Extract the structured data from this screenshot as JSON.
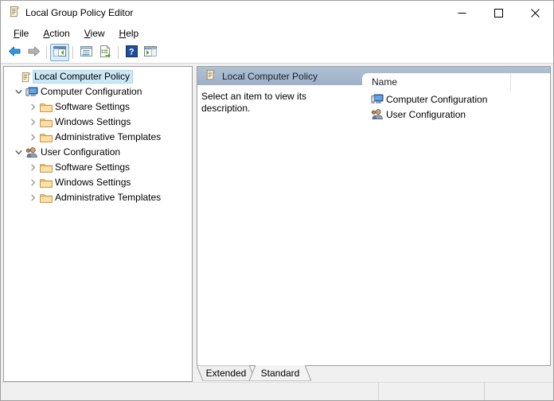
{
  "window": {
    "title": "Local Group Policy Editor",
    "app_icon": "policy-scroll-icon",
    "controls": {
      "minimize": "Minimize",
      "maximize": "Maximize",
      "close": "Close"
    }
  },
  "menubar": {
    "items": [
      {
        "label": "File",
        "accesskey": "F",
        "rest": "ile"
      },
      {
        "label": "Action",
        "accesskey": "A",
        "rest": "ction"
      },
      {
        "label": "View",
        "accesskey": "V",
        "rest": "iew"
      },
      {
        "label": "Help",
        "accesskey": "H",
        "rest": "elp"
      }
    ]
  },
  "toolbar": {
    "buttons": [
      {
        "name": "back-button",
        "icon": "back-arrow-icon",
        "state": "enabled"
      },
      {
        "name": "forward-button",
        "icon": "forward-arrow-icon",
        "state": "disabled"
      },
      {
        "name": "show-hide-tree-button",
        "icon": "show-console-tree-icon",
        "state": "checked"
      },
      {
        "name": "properties-button",
        "icon": "properties-icon",
        "state": "enabled"
      },
      {
        "name": "export-list-button",
        "icon": "export-list-icon",
        "state": "enabled"
      },
      {
        "name": "help-button",
        "icon": "help-question-icon",
        "state": "enabled"
      },
      {
        "name": "show-hide-action-pane-button",
        "icon": "action-pane-icon",
        "state": "enabled"
      }
    ]
  },
  "tree": {
    "nodes": [
      {
        "label": "Local Computer Policy",
        "icon": "policy-scroll-icon",
        "indent": 0,
        "twisty": "none",
        "selected": true
      },
      {
        "label": "Computer Configuration",
        "icon": "computer-icon",
        "indent": 1,
        "twisty": "expanded",
        "selected": false
      },
      {
        "label": "Software Settings",
        "icon": "folder-icon",
        "indent": 2,
        "twisty": "collapsed",
        "selected": false
      },
      {
        "label": "Windows Settings",
        "icon": "folder-icon",
        "indent": 2,
        "twisty": "collapsed",
        "selected": false
      },
      {
        "label": "Administrative Templates",
        "icon": "folder-icon",
        "indent": 2,
        "twisty": "collapsed",
        "selected": false
      },
      {
        "label": "User Configuration",
        "icon": "user-icon",
        "indent": 1,
        "twisty": "expanded",
        "selected": false
      },
      {
        "label": "Software Settings",
        "icon": "folder-icon",
        "indent": 2,
        "twisty": "collapsed",
        "selected": false
      },
      {
        "label": "Windows Settings",
        "icon": "folder-icon",
        "indent": 2,
        "twisty": "collapsed",
        "selected": false
      },
      {
        "label": "Administrative Templates",
        "icon": "folder-icon",
        "indent": 2,
        "twisty": "collapsed",
        "selected": false
      }
    ]
  },
  "details": {
    "header_title": "Local Computer Policy",
    "header_icon": "policy-scroll-icon",
    "description": "Select an item to view its description.",
    "columns": [
      "Name"
    ],
    "rows": [
      {
        "name": "Computer Configuration",
        "icon": "computer-icon"
      },
      {
        "name": "User Configuration",
        "icon": "user-icon"
      }
    ],
    "tabs": [
      {
        "label": "Extended",
        "selected": false
      },
      {
        "label": "Standard",
        "selected": true
      }
    ]
  },
  "statusbar": {
    "panes": [
      "",
      "",
      ""
    ]
  },
  "colors": {
    "header_bar": "#9db0c8",
    "selection": "#cce8f5",
    "window_border": "#9e9e9e",
    "chrome": "#f0f0f0",
    "folder": "#ffd27f"
  }
}
